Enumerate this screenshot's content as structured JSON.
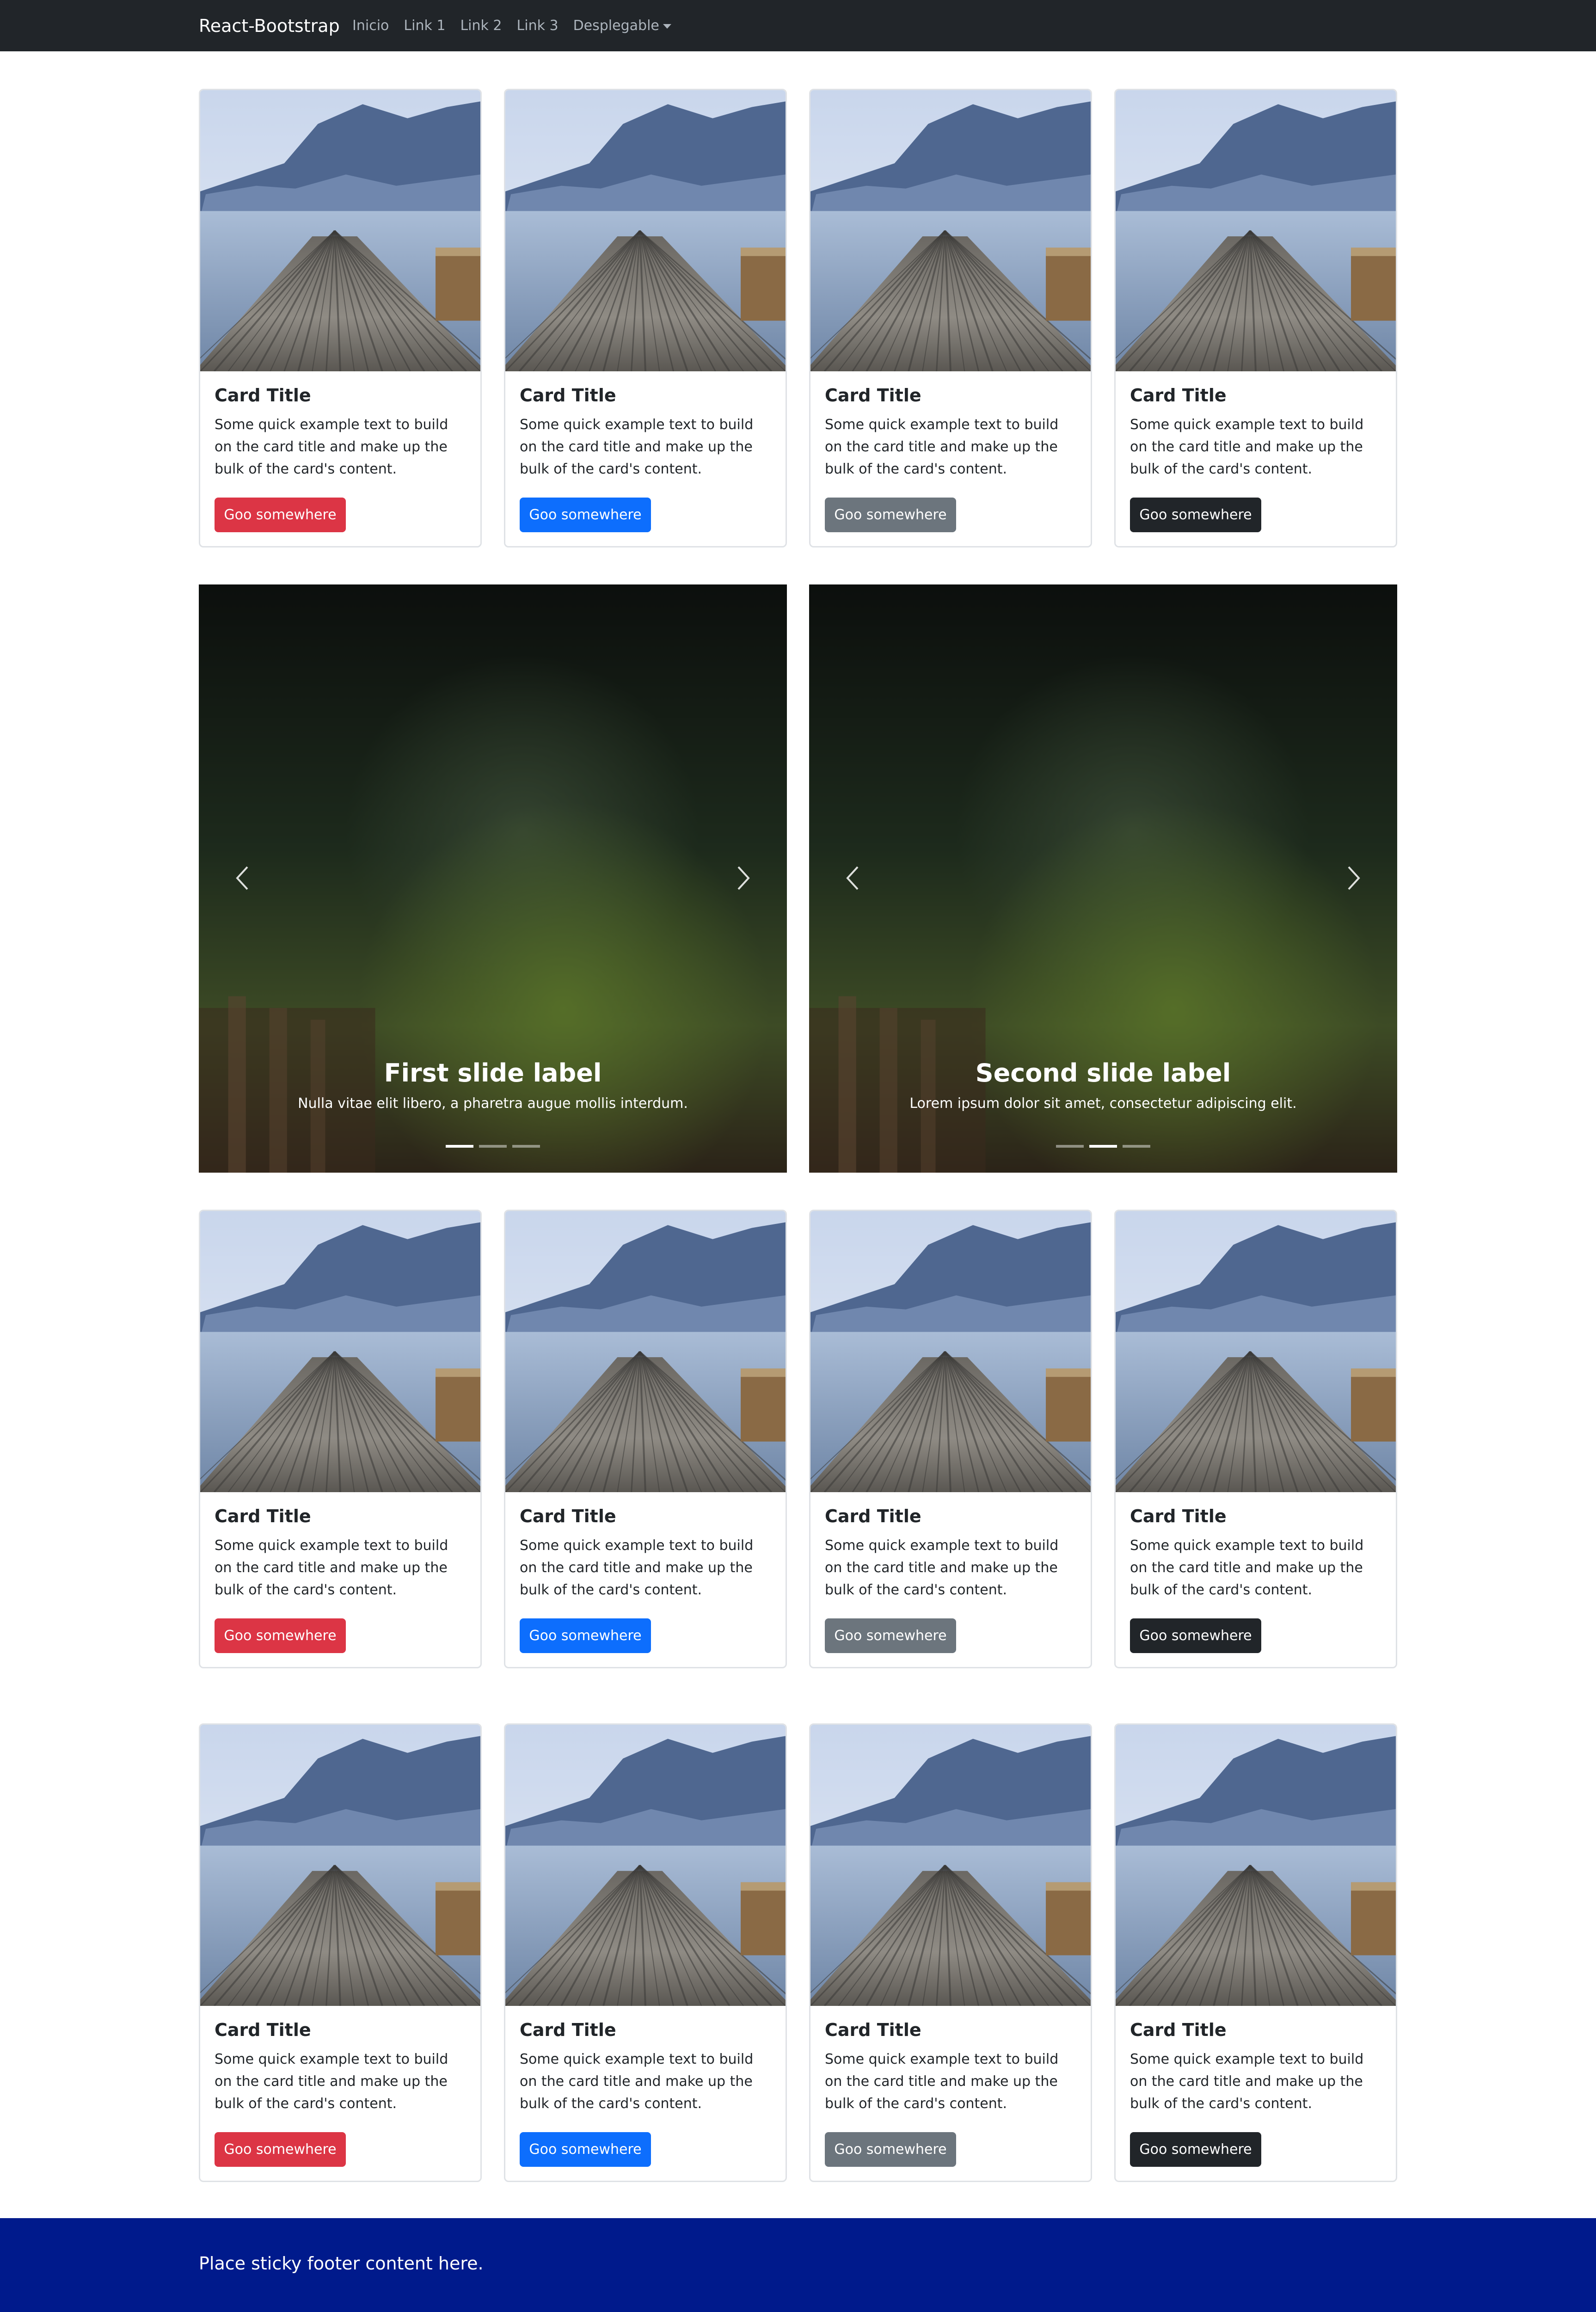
{
  "navbar": {
    "brand": "React-Bootstrap",
    "links": [
      "Inicio",
      "Link 1",
      "Link 2",
      "Link 3"
    ],
    "dropdown": "Desplegable"
  },
  "card": {
    "title": "Card Title",
    "text": "Some quick example text to build on the card title and make up the bulk of the card's content.",
    "button": "Goo somewhere"
  },
  "button_colors": [
    "#dc3545",
    "#0d6efd",
    "#6c757d",
    "#212529"
  ],
  "carousels": [
    {
      "title": "First slide label",
      "text": "Nulla vitae elit libero, a pharetra augue mollis interdum.",
      "active_indicator": 0,
      "indicator_count": 3
    },
    {
      "title": "Second slide label",
      "text": "Lorem ipsum dolor sit amet, consectetur adipiscing elit.",
      "active_indicator": 1,
      "indicator_count": 3
    }
  ],
  "footer": {
    "text": "Place sticky footer content here."
  }
}
